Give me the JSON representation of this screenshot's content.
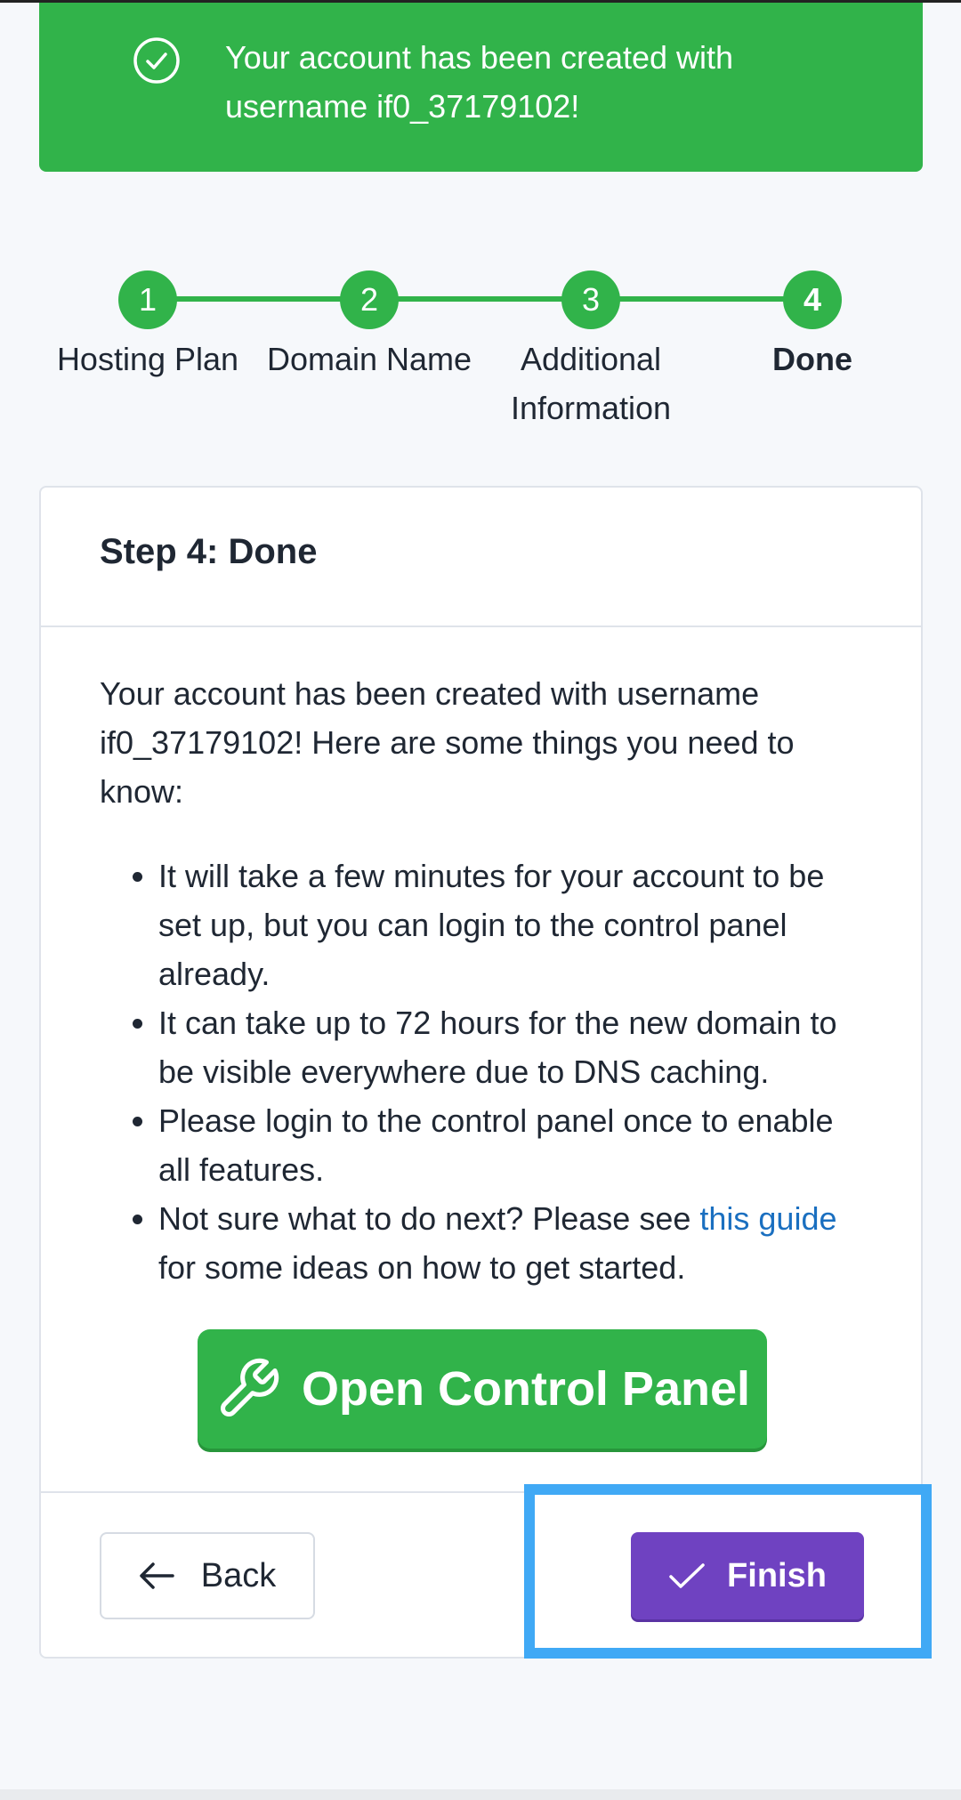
{
  "alert": {
    "message": "Your account has been created with username if0_37179102!",
    "icon": "check-circle-icon",
    "color": "#31b34a"
  },
  "stepper": {
    "steps": [
      {
        "number": "1",
        "label": "Hosting Plan"
      },
      {
        "number": "2",
        "label": "Domain Name"
      },
      {
        "number": "3",
        "label": "Additional Information"
      },
      {
        "number": "4",
        "label": "Done"
      }
    ],
    "active_step": 4
  },
  "card": {
    "title": "Step 4: Done",
    "intro": "Your account has been created with username if0_37179102! Here are some things you need to know:",
    "bullets": [
      "It will take a few minutes for your account to be set up, but you can login to the control panel already.",
      "It can take up to 72 hours for the new domain to be visible everywhere due to DNS caching.",
      "Please login to the control panel once to enable all features."
    ],
    "last_bullet": {
      "before": "Not sure what to do next? Please see ",
      "link": "this guide",
      "after": " for some ideas on how to get started."
    },
    "control_panel_button": "Open Control Panel",
    "back_button": "Back",
    "finish_button": "Finish"
  },
  "colors": {
    "success": "#31b34a",
    "primary": "#6f42c1",
    "link": "#1a6fc0",
    "highlight": "#40a9f5"
  }
}
